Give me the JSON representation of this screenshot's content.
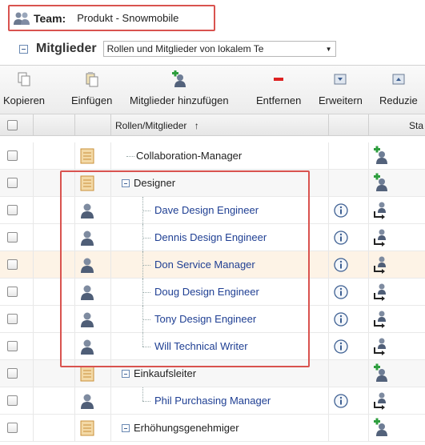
{
  "team": {
    "label": "Team:",
    "value": "Produkt - Snowmobile"
  },
  "mitglieder": {
    "title": "Mitglieder",
    "view_selected": "Rollen und Mitglieder von lokalem Te"
  },
  "toolbar": {
    "copy": "Kopieren",
    "paste": "Einfügen",
    "add_members": "Mitglieder hinzufügen",
    "remove": "Entfernen",
    "expand": "Erweitern",
    "reduce": "Reduzie"
  },
  "grid": {
    "header_roles": "Rollen/Mitglieder",
    "header_sort": "↑",
    "header_status": "Sta"
  },
  "rows": [
    {
      "type": "role",
      "name": "Collaboration-Manager"
    },
    {
      "type": "role",
      "name": "Designer"
    },
    {
      "type": "member",
      "name": "Dave Design Engineer"
    },
    {
      "type": "member",
      "name": "Dennis Design Engineer"
    },
    {
      "type": "member",
      "name": "Don Service Manager"
    },
    {
      "type": "member",
      "name": "Doug Design Engineer"
    },
    {
      "type": "member",
      "name": "Tony Design Engineer"
    },
    {
      "type": "member",
      "name": "Will Technical Writer"
    },
    {
      "type": "role",
      "name": "Einkaufsleiter"
    },
    {
      "type": "member",
      "name": "Phil Purchasing Manager"
    },
    {
      "type": "role",
      "name": "Erhöhungsgenehmiger"
    }
  ],
  "colors": {
    "accent_red": "#d9534f",
    "member_link": "#1f3f93"
  }
}
